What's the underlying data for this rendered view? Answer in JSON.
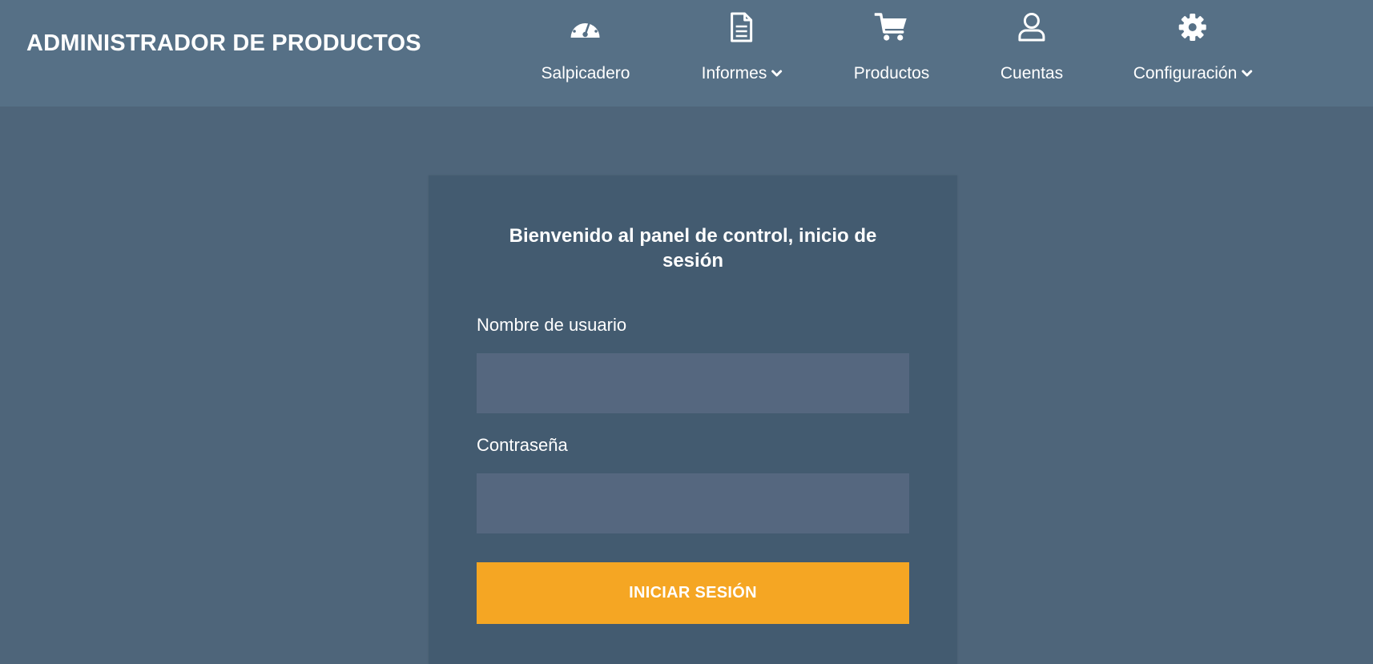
{
  "navbar": {
    "brand": "ADMINISTRADOR DE PRODUCTOS",
    "items": [
      {
        "label": "Salpicadero",
        "icon": "tachometer-icon",
        "has_dropdown": false
      },
      {
        "label": "Informes",
        "icon": "file-icon",
        "has_dropdown": true
      },
      {
        "label": "Productos",
        "icon": "shopping-cart-icon",
        "has_dropdown": false
      },
      {
        "label": "Cuentas",
        "icon": "user-icon",
        "has_dropdown": false
      },
      {
        "label": "Configuración",
        "icon": "gear-icon",
        "has_dropdown": true
      }
    ]
  },
  "login": {
    "title": "Bienvenido al panel de control, inicio de sesión",
    "username_label": "Nombre de usuario",
    "username_value": "",
    "password_label": "Contraseña",
    "password_value": "",
    "submit_label": "INICIAR SESIÓN"
  },
  "colors": {
    "background": "#4e657a",
    "navbar": "#567086",
    "card": "#435b70",
    "input": "#55677f",
    "accent": "#f5a623",
    "text": "#ffffff"
  }
}
